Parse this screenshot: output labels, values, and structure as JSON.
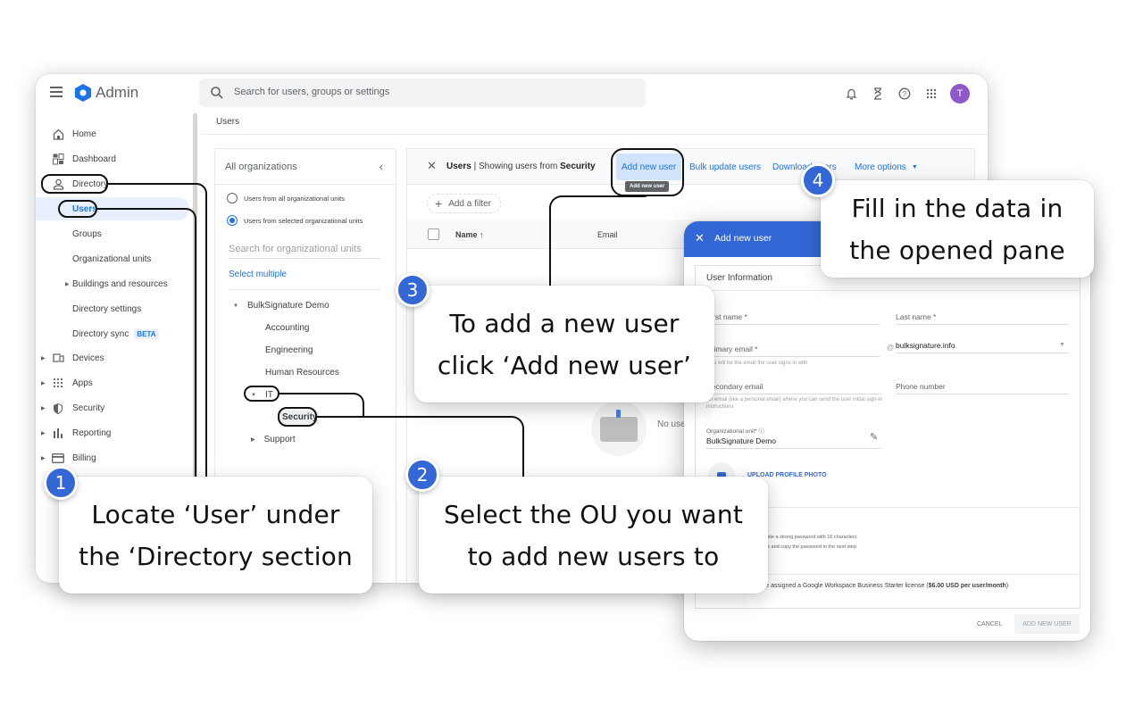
{
  "app": {
    "title": "Admin",
    "search_placeholder": "Search for users, groups or settings",
    "avatar_initial": "T",
    "top_icons": [
      "bell-icon",
      "hourglass-icon",
      "help-icon",
      "apps-grid-icon"
    ]
  },
  "sidebar": {
    "items": [
      {
        "label": "Home",
        "icon": "home-icon"
      },
      {
        "label": "Dashboard",
        "icon": "dashboard-icon"
      },
      {
        "label": "Directory",
        "icon": "person-icon"
      },
      {
        "label": "Users"
      },
      {
        "label": "Groups"
      },
      {
        "label": "Organizational units"
      },
      {
        "label": "Buildings and resources"
      },
      {
        "label": "Directory settings"
      },
      {
        "label": "Directory sync",
        "badge": "BETA"
      },
      {
        "label": "Devices",
        "icon": "devices-icon"
      },
      {
        "label": "Apps",
        "icon": "apps-icon"
      },
      {
        "label": "Security",
        "icon": "shield-icon"
      },
      {
        "label": "Reporting",
        "icon": "bar-chart-icon"
      },
      {
        "label": "Billing",
        "icon": "credit-card-icon"
      }
    ]
  },
  "breadcrumb": "Users",
  "org_panel": {
    "title": "All organizations",
    "radio_all": "Users from all organizational units",
    "radio_selected": "Users from selected organizational units",
    "search_placeholder": "Search for organizational units",
    "select_multiple": "Select multiple",
    "tree": {
      "root": "BulkSignature Demo",
      "children": [
        "Accounting",
        "Engineering",
        "Human Resources",
        "IT",
        "Security",
        "Support"
      ]
    }
  },
  "users_panel": {
    "title_prefix": "Users",
    "title_mid": " | Showing users from ",
    "title_ou": "Security",
    "actions": {
      "add_new_user": "Add new user",
      "bulk_update": "Bulk update users",
      "download": "Download users",
      "more_options": "More options"
    },
    "tooltip": "Add new user",
    "add_filter": "Add a filter",
    "columns": {
      "name": "Name",
      "email": "Email"
    },
    "empty_text": "No users"
  },
  "add_user_pane": {
    "title": "Add new user",
    "section_title": "User Information",
    "first_name": "First name *",
    "last_name": "Last name *",
    "primary_email": "Primary email *",
    "primary_email_hint": "This will be the email the user signs in with",
    "domain": "bulksignature.info",
    "secondary_email": "Secondary email",
    "secondary_email_hint": "An email (like a personal email) where you can send the user initial sign-in instructions",
    "phone_number": "Phone number",
    "ou_label": "Organizational unit*",
    "ou_value": "BulkSignature Demo",
    "upload_photo": "UPLOAD PROFILE PHOTO",
    "password_line1": "Automatically generate a strong password with 16 characters",
    "password_line2": "You'll be able to view and copy the password in the next step",
    "license_text": "This user will be assigned a Google Workspace Business Starter license (",
    "license_price": "$6.00 USD per user/month",
    "license_close": ")",
    "cancel": "CANCEL",
    "submit": "ADD NEW USER"
  },
  "callouts": [
    {
      "step": "1",
      "line1": "Locate ‘User’ under",
      "line2": "the ‘Directory section"
    },
    {
      "step": "2",
      "line1": "Select the OU you want",
      "line2": "to add new users to"
    },
    {
      "step": "3",
      "line1": "To add a new user",
      "line2": "click ‘Add new user’"
    },
    {
      "step": "4",
      "line1": "Fill in the data in",
      "line2": "the opened pane"
    }
  ],
  "colors": {
    "accent": "#1a73e8",
    "pane_header": "#3367d6",
    "badge": "#3367d6",
    "avatar": "#8e58c8"
  }
}
